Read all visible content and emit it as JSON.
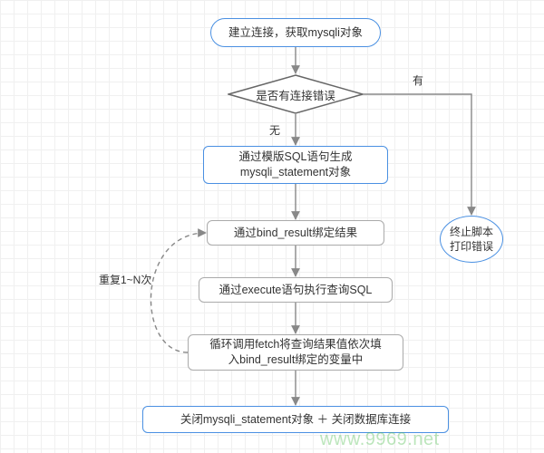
{
  "diagram": {
    "start": "建立连接，获取mysqli对象",
    "decision": "是否有连接错误",
    "edge_no": "无",
    "edge_yes": "有",
    "gen_stmt": "通过模版SQL语句生成\nmysqli_statement对象",
    "bind_result": "通过bind_result绑定结果",
    "execute": "通过execute语句执行查询SQL",
    "fetch_loop": "循环调用fetch将查询结果值依次填\n入bind_result绑定的变量中",
    "close": "关闭mysqli_statement对象 ＋ 关闭数据库连接",
    "loop_label": "重复1~N次",
    "terminate": "终止脚本\n打印错误",
    "watermark": "www.9969.net"
  },
  "colors": {
    "accent": "#4a90e2",
    "line": "#888888",
    "decision_border": "#666666"
  }
}
